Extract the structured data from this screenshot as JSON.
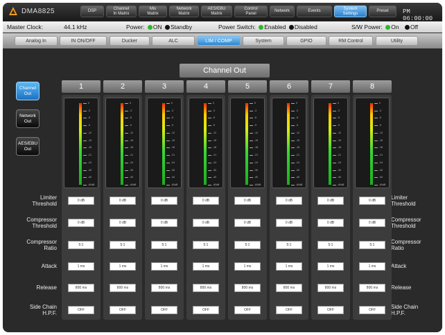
{
  "header": {
    "device_name": "DMA8825",
    "time": "PM 06:00:00",
    "nav": [
      {
        "label": "DSP"
      },
      {
        "label": "Channel\nIn Matrix"
      },
      {
        "label": "Mix\nMatrix"
      },
      {
        "label": "Network\nMatrix"
      },
      {
        "label": "AES/EBU\nMatrix"
      },
      {
        "label": "Control\nPanel"
      },
      {
        "label": "Network"
      },
      {
        "label": "Events"
      },
      {
        "label": "System\nSettings",
        "active": true
      },
      {
        "label": "Preset"
      }
    ]
  },
  "status": {
    "master_clock_label": "Master Clock:",
    "master_clock_value": "44.1 kHz",
    "power_label": "Power:",
    "power_on": "ON",
    "power_standby": "Standby",
    "power_switch_label": "Power Switch:",
    "power_switch_enabled": "Enabled",
    "power_switch_disabled": "Disabled",
    "sw_power_label": "S/W Power:",
    "sw_power_on": "On",
    "sw_power_off": "Off"
  },
  "tabs": [
    {
      "label": "Analog In"
    },
    {
      "label": "IN ON/OFF"
    },
    {
      "label": "Ducker"
    },
    {
      "label": "ALC"
    },
    {
      "label": "LIM / COMP",
      "active": true
    },
    {
      "label": "System"
    },
    {
      "label": "GPIO"
    },
    {
      "label": "RM Control"
    },
    {
      "label": "Utility"
    }
  ],
  "side_buttons": [
    {
      "label": "Channel\nOut",
      "active": true
    },
    {
      "label": "Network\nOut"
    },
    {
      "label": "AES/EBU\nOut"
    }
  ],
  "section_title": "Channel Out",
  "meter_scale": [
    "0",
    "-3",
    "-6",
    "-9",
    "-12",
    "-15",
    "-18",
    "-21",
    "-24",
    "-30",
    "-40",
    "-60dB"
  ],
  "channels": [
    {
      "number": "1",
      "limiter_threshold": "0 dB",
      "compressor_threshold": "0 dB",
      "compressor_ratio": "5:1",
      "attack": "1 ms",
      "release": "800 ms",
      "side_chain_hpf": "OFF"
    },
    {
      "number": "2",
      "limiter_threshold": "0 dB",
      "compressor_threshold": "0 dB",
      "compressor_ratio": "5:1",
      "attack": "1 ms",
      "release": "800 ms",
      "side_chain_hpf": "OFF"
    },
    {
      "number": "3",
      "limiter_threshold": "0 dB",
      "compressor_threshold": "0 dB",
      "compressor_ratio": "5:1",
      "attack": "1 ms",
      "release": "800 ms",
      "side_chain_hpf": "OFF"
    },
    {
      "number": "4",
      "limiter_threshold": "0 dB",
      "compressor_threshold": "0 dB",
      "compressor_ratio": "5:1",
      "attack": "1 ms",
      "release": "800 ms",
      "side_chain_hpf": "OFF"
    },
    {
      "number": "5",
      "limiter_threshold": "0 dB",
      "compressor_threshold": "0 dB",
      "compressor_ratio": "5:1",
      "attack": "1 ms",
      "release": "800 ms",
      "side_chain_hpf": "OFF"
    },
    {
      "number": "6",
      "limiter_threshold": "0 dB",
      "compressor_threshold": "0 dB",
      "compressor_ratio": "5:1",
      "attack": "1 ms",
      "release": "800 ms",
      "side_chain_hpf": "OFF"
    },
    {
      "number": "7",
      "limiter_threshold": "0 dB",
      "compressor_threshold": "0 dB",
      "compressor_ratio": "5:1",
      "attack": "1 ms",
      "release": "800 ms",
      "side_chain_hpf": "OFF"
    },
    {
      "number": "8",
      "limiter_threshold": "0 dB",
      "compressor_threshold": "0 dB",
      "compressor_ratio": "5:1",
      "attack": "1 ms",
      "release": "800 ms",
      "side_chain_hpf": "OFF"
    }
  ],
  "rows": [
    {
      "key": "limiter_threshold",
      "label": "Limiter\nThreshold"
    },
    {
      "key": "compressor_threshold",
      "label": "Compressor\nThreshold"
    },
    {
      "key": "compressor_ratio",
      "label": "Compressor\nRatio"
    },
    {
      "key": "attack",
      "label": "Attack"
    },
    {
      "key": "release",
      "label": "Release"
    },
    {
      "key": "side_chain_hpf",
      "label": "Side Chain\nH.P.F."
    }
  ],
  "colors": {
    "accent": "#2e86d0",
    "background": "#2a2a2a",
    "power_on": "#2fb62f"
  }
}
